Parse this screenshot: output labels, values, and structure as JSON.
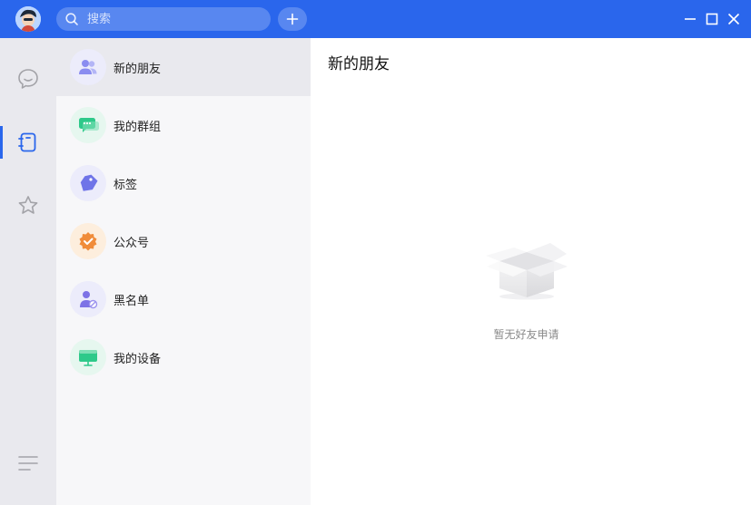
{
  "titlebar": {
    "search": {
      "placeholder": "搜索"
    },
    "icons": {
      "search": "search-icon",
      "add": "plus-icon",
      "minimize": "minimize-icon",
      "maximize": "maximize-icon",
      "close": "close-icon"
    }
  },
  "sidebar": {
    "items": [
      {
        "icon": "chat-bubble-icon",
        "active": false
      },
      {
        "icon": "contacts-book-icon",
        "active": true
      },
      {
        "icon": "star-icon",
        "active": false
      },
      {
        "icon": "menu-lines-icon",
        "active": false
      }
    ],
    "accent": "#2a66ec"
  },
  "contacts": {
    "items": [
      {
        "label": "新的朋友",
        "icon": "new-friends-icon",
        "color": "#8a8cf0",
        "selected": true
      },
      {
        "label": "我的群组",
        "icon": "group-chat-icon",
        "color": "#2ec98a",
        "selected": false
      },
      {
        "label": "标签",
        "icon": "tag-icon",
        "color": "#6f74e8",
        "selected": false
      },
      {
        "label": "公众号",
        "icon": "official-account-icon",
        "color": "#f08c3a",
        "selected": false
      },
      {
        "label": "黑名单",
        "icon": "blacklist-icon",
        "color": "#7d72e6",
        "selected": false
      },
      {
        "label": "我的设备",
        "icon": "device-icon",
        "color": "#2ec98a",
        "selected": false
      }
    ]
  },
  "main": {
    "title": "新的朋友",
    "empty_icon": "empty-box-icon",
    "empty_text": "暂无好友申请"
  },
  "colors": {
    "titlebar": "#2a66ec",
    "iconbar": "#e9e9ee",
    "panel": "#f7f7f9"
  }
}
